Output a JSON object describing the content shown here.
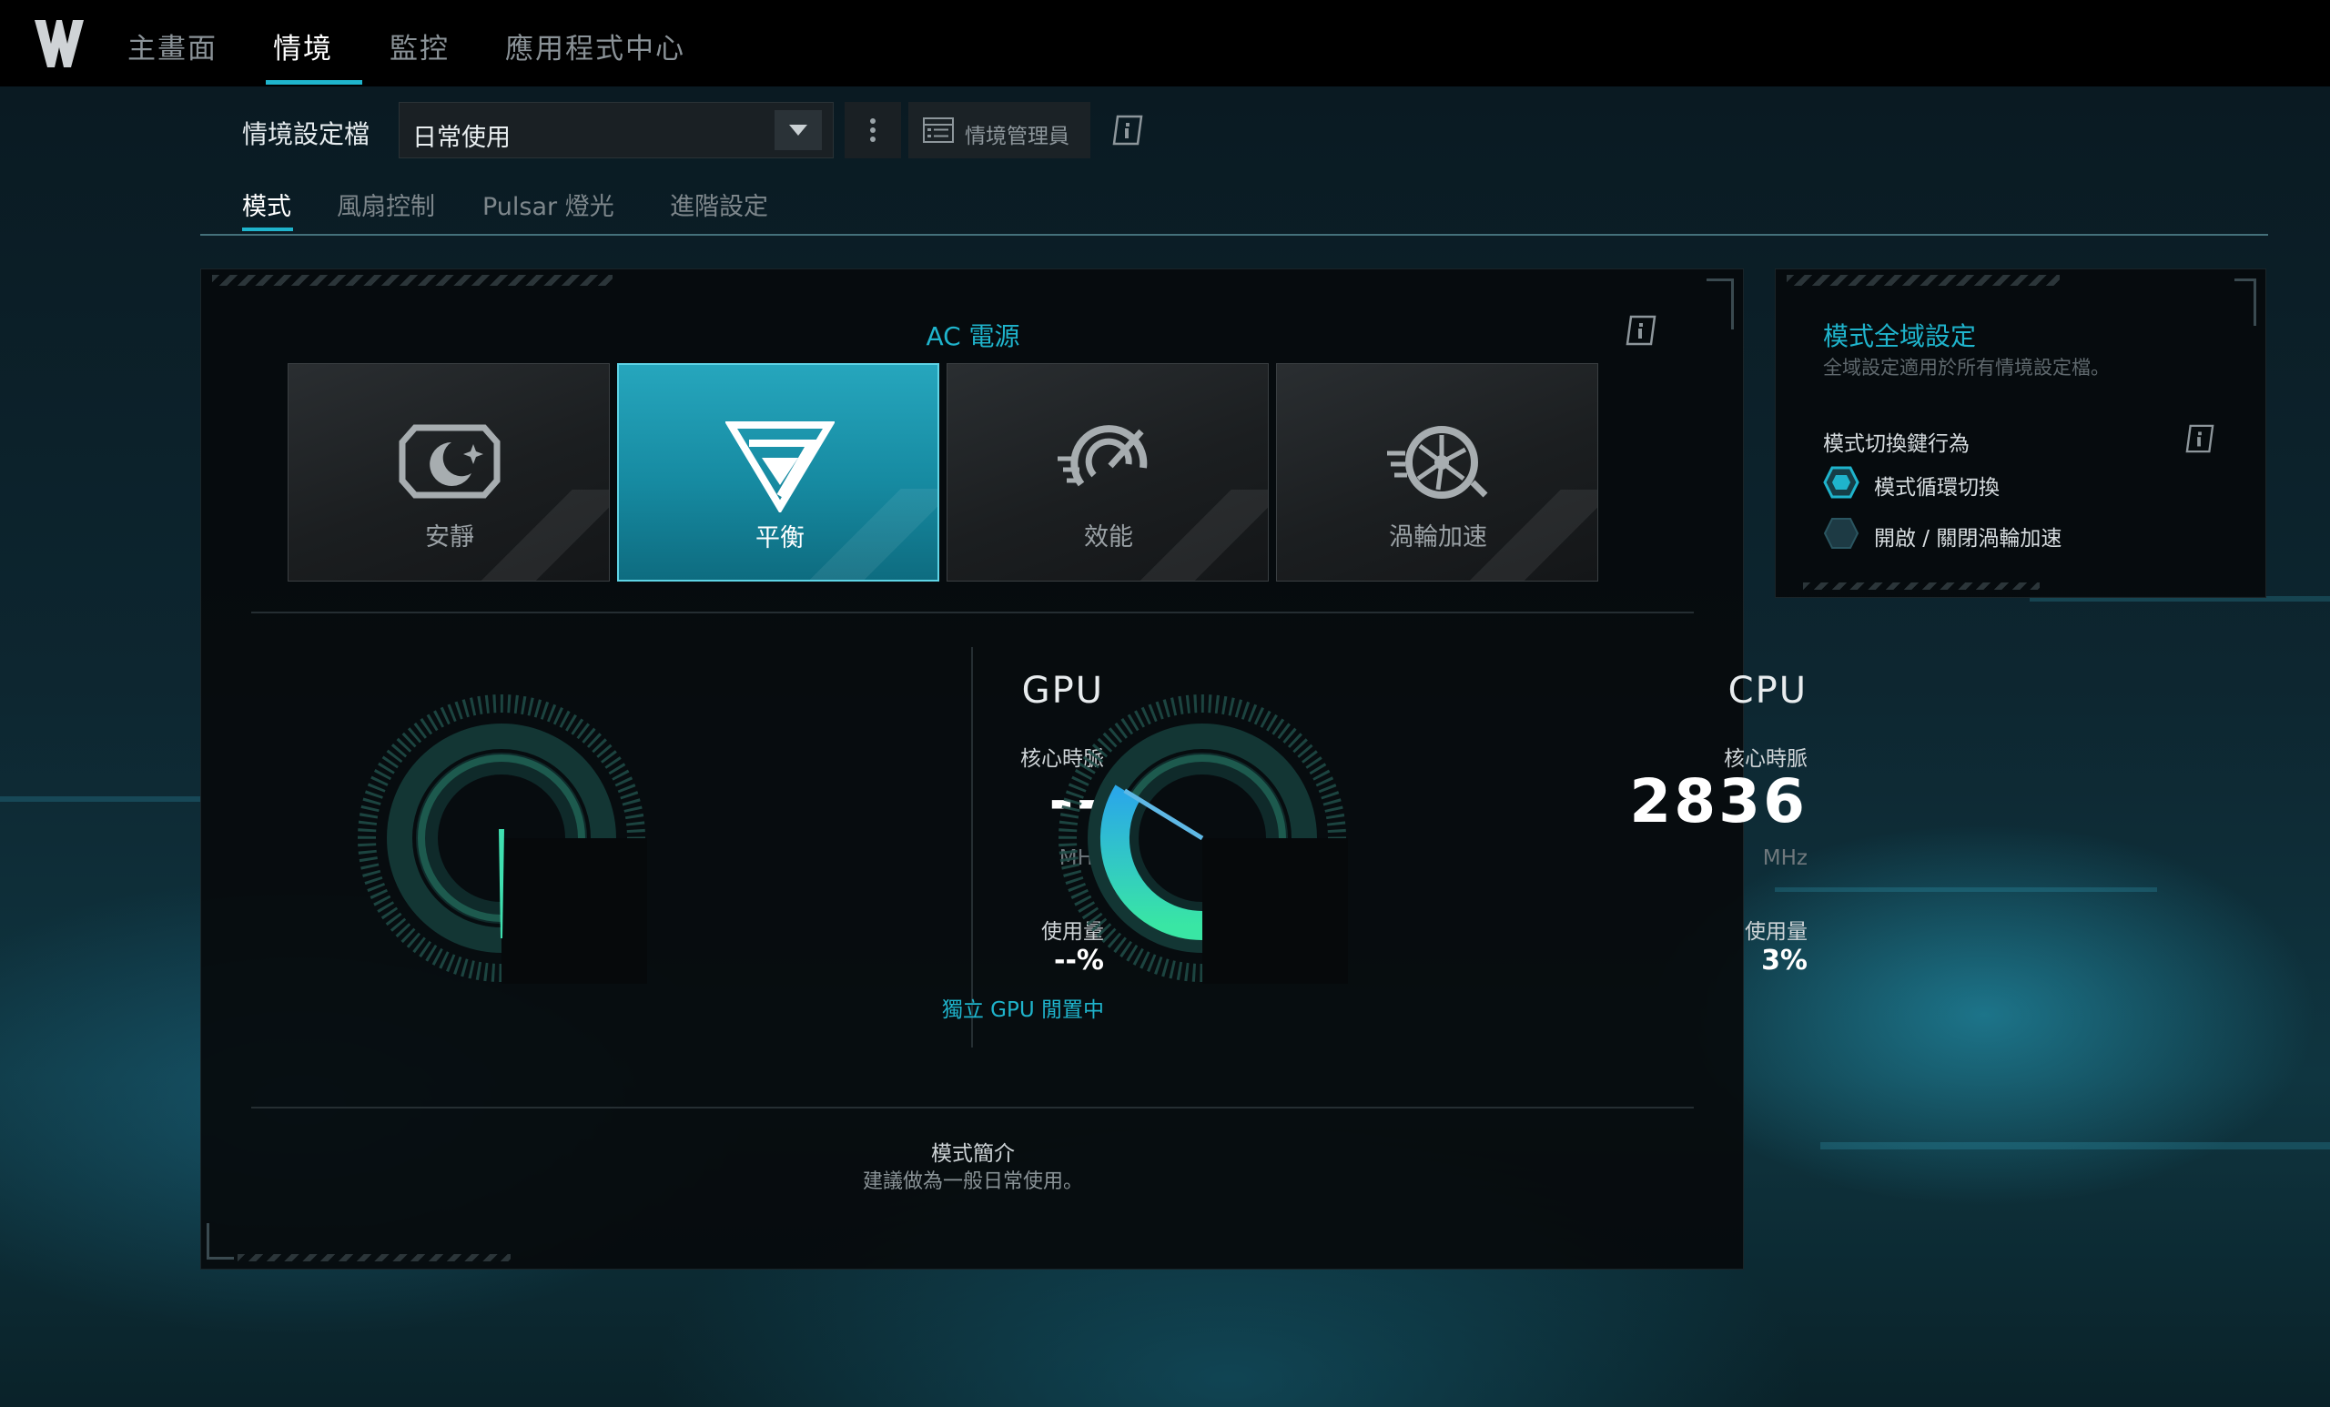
{
  "nav": {
    "items": [
      {
        "label": "主畫面"
      },
      {
        "label": "情境"
      },
      {
        "label": "監控"
      },
      {
        "label": "應用程式中心"
      }
    ],
    "active_index": 1
  },
  "profile": {
    "label": "情境設定檔",
    "selected": "日常使用",
    "manager_label": "情境管理員"
  },
  "subtabs": [
    {
      "label": "模式"
    },
    {
      "label": "風扇控制"
    },
    {
      "label": "Pulsar 燈光"
    },
    {
      "label": "進階設定"
    }
  ],
  "power": {
    "title": "AC 電源",
    "modes": [
      {
        "label": "安靜",
        "icon": "moon-stars-icon"
      },
      {
        "label": "平衡",
        "icon": "triangle-balance-icon"
      },
      {
        "label": "效能",
        "icon": "speedometer-icon"
      },
      {
        "label": "渦輪加速",
        "icon": "turbo-fan-icon"
      }
    ],
    "selected_index": 1
  },
  "gpu": {
    "name": "GPU",
    "clock_label": "核心時脈",
    "clock_value": "--",
    "clock_unit": "MHz",
    "usage_label": "使用量",
    "usage_value": "--%",
    "note": "獨立 GPU 閒置中",
    "gauge_fraction": 0.0
  },
  "cpu": {
    "name": "CPU",
    "clock_label": "核心時脈",
    "clock_value": "2836",
    "clock_unit": "MHz",
    "usage_label": "使用量",
    "usage_value": "3%",
    "gauge_fraction": 0.45
  },
  "mode_desc": {
    "title": "模式簡介",
    "text": "建議做為一般日常使用。"
  },
  "global": {
    "title": "模式全域設定",
    "subtitle": "全域設定適用於所有情境設定檔。",
    "switch_label": "模式切換鍵行為",
    "options": [
      {
        "label": "模式循環切換"
      },
      {
        "label": "開啟 / 關閉渦輪加速"
      }
    ],
    "selected_index": 0
  },
  "colors": {
    "accent": "#1fb4cc",
    "gauge_start": "#2aa8e8",
    "gauge_end": "#39e6a4"
  }
}
